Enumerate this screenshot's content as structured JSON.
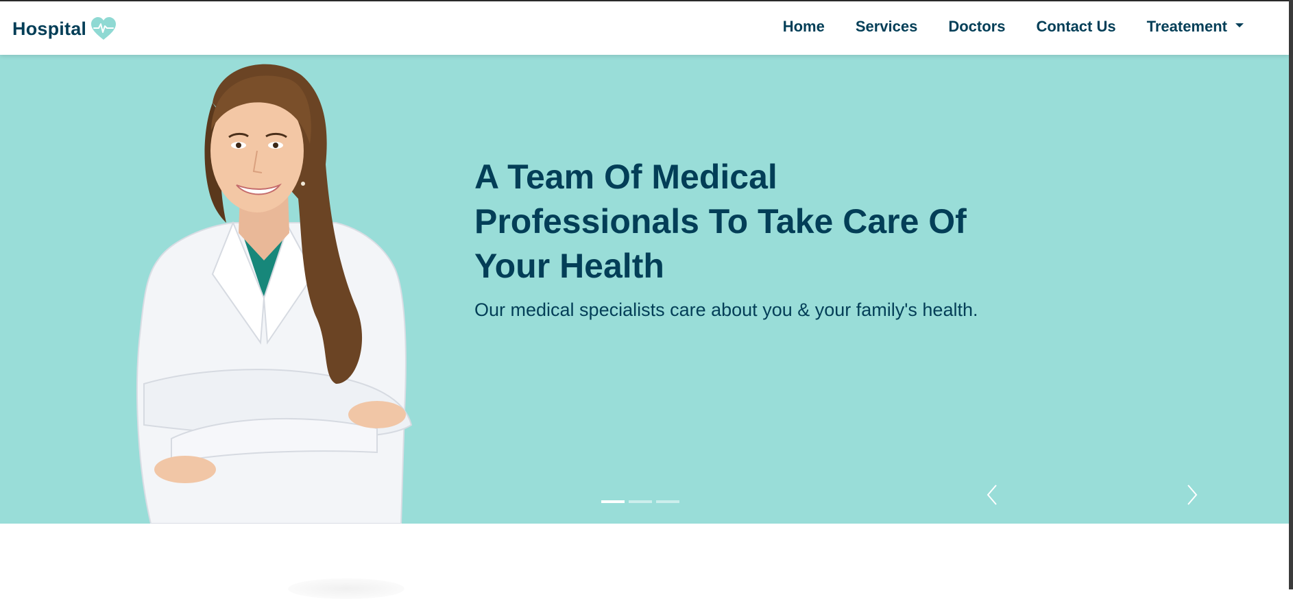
{
  "brand": {
    "name": "Hospital",
    "icon": "heart-pulse-icon"
  },
  "nav": {
    "items": [
      {
        "label": "Home"
      },
      {
        "label": "Services"
      },
      {
        "label": "Doctors"
      },
      {
        "label": "Contact Us"
      },
      {
        "label": "Treatement"
      }
    ]
  },
  "hero": {
    "title_lines": [
      "A Team Of Medical",
      "Professionals To Take Care Of",
      "Your Health"
    ],
    "subtitle": "Our medical specialists care about you & your family's health.",
    "slides_count": 3,
    "active_slide": 1
  },
  "colors": {
    "primary": "#033e57",
    "hero_bg": "#99ddd8",
    "nav_bg": "#ffffff"
  }
}
